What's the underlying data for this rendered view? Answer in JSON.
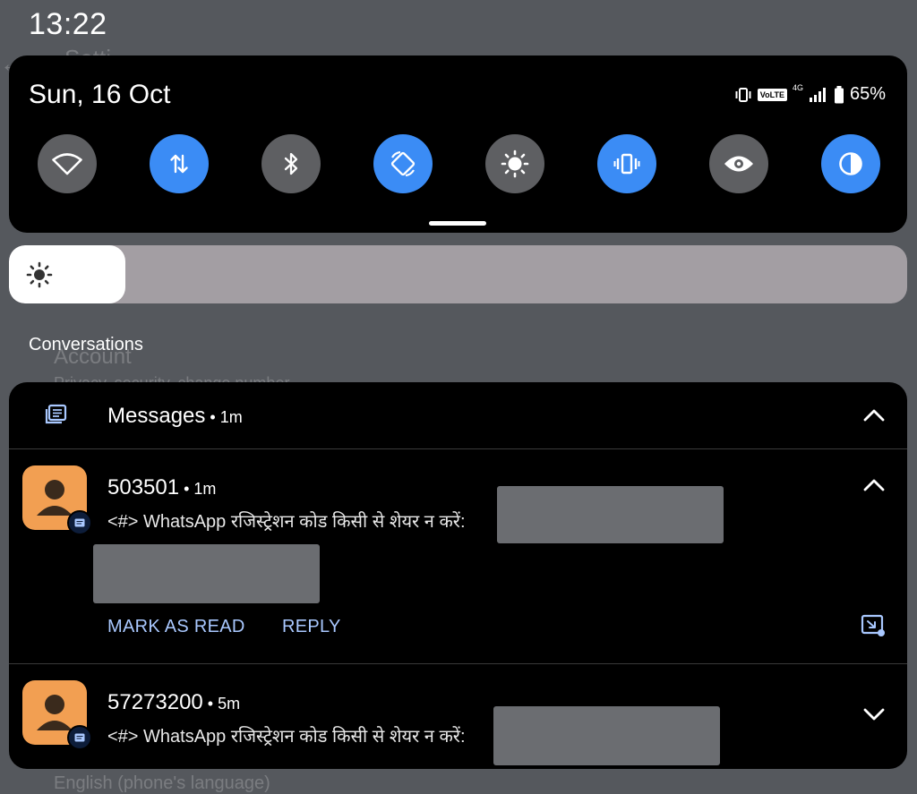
{
  "status_bar": {
    "time": "13:22"
  },
  "quick_settings": {
    "date": "Sun, 16 Oct",
    "status": {
      "volte": "VoLTE",
      "network": "4G",
      "battery": "65%"
    },
    "tiles": [
      {
        "name": "wifi",
        "state": "off"
      },
      {
        "name": "mobile-data",
        "state": "on"
      },
      {
        "name": "bluetooth",
        "state": "off"
      },
      {
        "name": "auto-rotate",
        "state": "on"
      },
      {
        "name": "brightness-mode",
        "state": "off"
      },
      {
        "name": "vibrate",
        "state": "on"
      },
      {
        "name": "eye-comfort",
        "state": "off"
      },
      {
        "name": "dark-theme",
        "state": "on"
      }
    ]
  },
  "brightness": {
    "level": 0.13
  },
  "background_ghost": {
    "settings_title": "Setti",
    "account": "Account",
    "privacy": "Privacy, security, change number",
    "language": "English (phone's language)"
  },
  "conversations": {
    "section_title": "Conversations",
    "app_name": "Messages",
    "app_time": "1m",
    "items": [
      {
        "sender": "503501",
        "time": "1m",
        "text": "<#> WhatsApp रजिस्ट्रेशन कोड किसी से शेयर न करें:",
        "actions": [
          "MARK AS READ",
          "REPLY"
        ]
      },
      {
        "sender": "57273200",
        "time": "5m",
        "text": "<#> WhatsApp रजिस्ट्रेशन कोड किसी से शेयर न करें:"
      }
    ]
  },
  "colors": {
    "accent": "#3b8cf5",
    "action_text": "#a9c8ff",
    "avatar": "#f29f52",
    "tile_off": "#5e5f62"
  }
}
